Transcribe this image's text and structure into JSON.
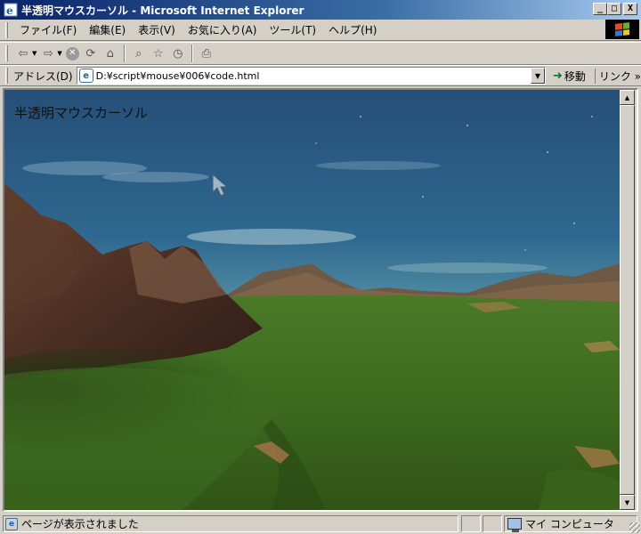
{
  "window": {
    "title": "半透明マウスカーソル - Microsoft Internet Explorer",
    "minimize": "_",
    "maximize": "□",
    "close": "X"
  },
  "menu": [
    {
      "id": "file",
      "label": "ファイル(F)"
    },
    {
      "id": "edit",
      "label": "編集(E)"
    },
    {
      "id": "view",
      "label": "表示(V)"
    },
    {
      "id": "favorites",
      "label": "お気に入り(A)"
    },
    {
      "id": "tools",
      "label": "ツール(T)"
    },
    {
      "id": "help",
      "label": "ヘルプ(H)"
    }
  ],
  "toolbar": {
    "icons": [
      "back-icon",
      "forward-icon",
      "stop-icon",
      "refresh-icon",
      "home-icon",
      "search-icon",
      "favorites-icon",
      "history-icon",
      "print-icon"
    ]
  },
  "address": {
    "label": "アドレス(D)",
    "url": "D:¥script¥mouse¥006¥code.html",
    "go_label": "移動",
    "links_label": "リンク »"
  },
  "page": {
    "heading": "半透明マウスカーソル"
  },
  "status": {
    "text": "ページが表示されました",
    "zone": "マイ コンピュータ"
  },
  "colors": {
    "titlebar_start": "#0a246a",
    "titlebar_end": "#a6caf0",
    "chrome": "#d4d0c8",
    "sky_top": "#254f78",
    "grass": "#3f6a1f"
  }
}
